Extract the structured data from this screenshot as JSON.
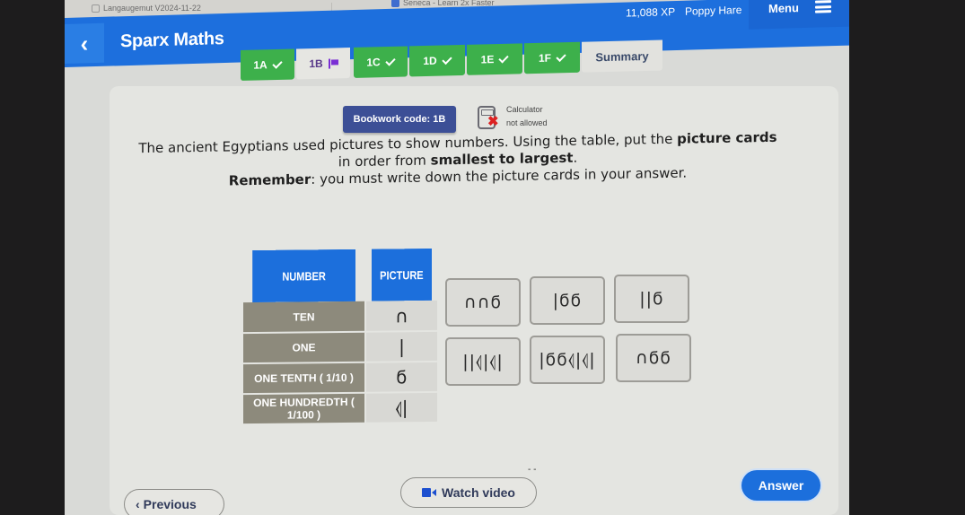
{
  "browser": {
    "tabs": [
      {
        "title": "Langaugemut V2024-11-22",
        "icon": "page-icon"
      },
      {
        "title": "Seneca - Learn 2x Faster",
        "icon": "seneca-icon"
      }
    ]
  },
  "header": {
    "back_icon": "chevron-left-icon",
    "title": "Sparx Maths",
    "xp": "11,088 XP",
    "user_name": "Poppy Hare",
    "menu_label": "Menu",
    "menu_icon": "hamburger-icon"
  },
  "tasks": [
    {
      "label": "1A",
      "status": "complete",
      "icon": "check-icon"
    },
    {
      "label": "1B",
      "status": "current",
      "icon": "flag-icon"
    },
    {
      "label": "1C",
      "status": "complete",
      "icon": "check-icon"
    },
    {
      "label": "1D",
      "status": "complete",
      "icon": "check-icon"
    },
    {
      "label": "1E",
      "status": "complete",
      "icon": "check-icon"
    },
    {
      "label": "1F",
      "status": "complete",
      "icon": "check-icon"
    },
    {
      "label": "Summary",
      "status": "summary"
    }
  ],
  "bookwork": {
    "label": "Bookwork code: 1B"
  },
  "calculator": {
    "line1": "Calculator",
    "line2": "not allowed",
    "icon": "calculator-not-allowed-icon"
  },
  "question": {
    "part1": "The ancient Egyptians used pictures to show numbers. Using the table, put the ",
    "bold1": "picture cards",
    "part2": " in order from ",
    "bold2": "smallest to largest",
    "part3": ".",
    "remember_bold": "Remember",
    "remember_text": ": you must write down the picture cards in your answer."
  },
  "table": {
    "headers": [
      "NUMBER",
      "PICTURE"
    ],
    "rows": [
      {
        "number": "TEN",
        "picture": "∩"
      },
      {
        "number": "ONE",
        "picture": "|"
      },
      {
        "number": "ONE TENTH ( 1/10 )",
        "picture": "ϭ"
      },
      {
        "number": "ONE HUNDREDTH ( 1/100 )",
        "picture": "⦉|"
      }
    ]
  },
  "cards": [
    {
      "symbols": "∩∩ϭ"
    },
    {
      "symbols": "|ϭϭ"
    },
    {
      "symbols": "||ϭ"
    },
    {
      "symbols": "||⦉|⦉|"
    },
    {
      "symbols": "|ϭϭ⦉|⦉|"
    },
    {
      "symbols": "∩ϭϭ"
    }
  ],
  "footer": {
    "previous_label": "Previous",
    "watch_video_label": "Watch video",
    "answer_label": "Answer"
  },
  "colors": {
    "brand_blue": "#1d6fdd",
    "complete_green": "#3db04b",
    "bookwork_navy": "#3c4f96",
    "flag_purple": "#7a2ed4",
    "table_row_gray": "#8d8a7c"
  }
}
